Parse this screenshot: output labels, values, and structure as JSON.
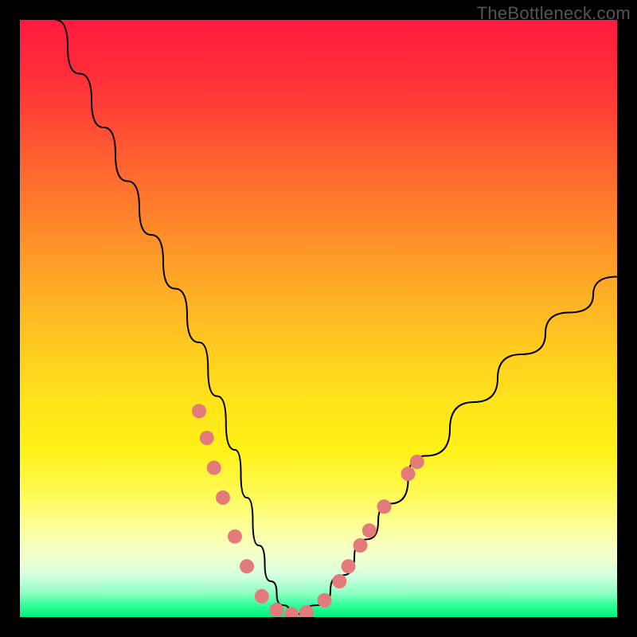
{
  "watermark": "TheBottleneck.com",
  "colors": {
    "marker": "#e47b7b",
    "curve": "#000000",
    "frame_bg": "#000000"
  },
  "chart_data": {
    "type": "line",
    "title": "",
    "xlabel": "",
    "ylabel": "",
    "xlim": [
      0,
      100
    ],
    "ylim": [
      0,
      100
    ],
    "grid": false,
    "legend": false,
    "series": [
      {
        "name": "bottleneck-curve",
        "x": [
          6,
          10,
          14,
          18,
          22,
          26,
          30,
          33,
          36,
          38,
          40,
          42,
          44,
          46,
          50,
          54,
          58,
          62,
          68,
          76,
          84,
          92,
          100
        ],
        "y": [
          100,
          91,
          82,
          73,
          64,
          55,
          46,
          37,
          28,
          20,
          12,
          6,
          2,
          0.5,
          2,
          7,
          13,
          19,
          27,
          36,
          44,
          51,
          57
        ]
      }
    ],
    "markers": [
      {
        "x": 30.0,
        "y": 34.5
      },
      {
        "x": 31.3,
        "y": 30.0
      },
      {
        "x": 32.5,
        "y": 25.0
      },
      {
        "x": 34.0,
        "y": 20.0
      },
      {
        "x": 36.0,
        "y": 13.5
      },
      {
        "x": 38.0,
        "y": 8.5
      },
      {
        "x": 40.5,
        "y": 3.5
      },
      {
        "x": 43.0,
        "y": 1.2
      },
      {
        "x": 45.5,
        "y": 0.5
      },
      {
        "x": 48.0,
        "y": 0.8
      },
      {
        "x": 51.0,
        "y": 2.8
      },
      {
        "x": 53.5,
        "y": 6.0
      },
      {
        "x": 55.0,
        "y": 8.5
      },
      {
        "x": 57.0,
        "y": 12.0
      },
      {
        "x": 58.5,
        "y": 14.5
      },
      {
        "x": 61.0,
        "y": 18.5
      },
      {
        "x": 65.0,
        "y": 24.0
      },
      {
        "x": 66.5,
        "y": 26.0
      }
    ]
  }
}
